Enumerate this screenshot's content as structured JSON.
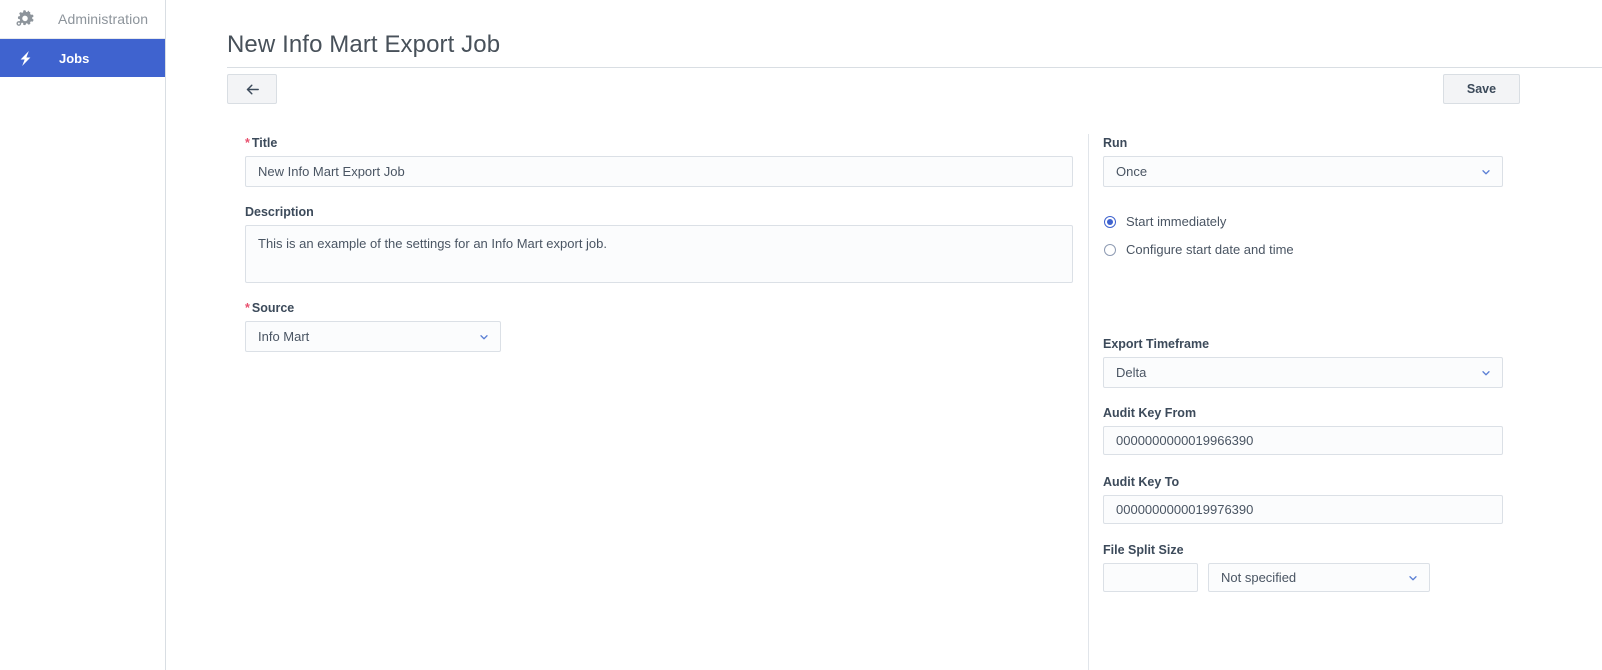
{
  "sidebar": {
    "items": [
      {
        "label": "Administration",
        "icon": "gears-icon",
        "active": false
      },
      {
        "label": "Jobs",
        "icon": "lightning-bolt-icon",
        "active": true
      }
    ]
  },
  "header": {
    "title": "New Info Mart Export Job"
  },
  "toolbar": {
    "back_icon": "arrow-left-icon",
    "save_label": "Save"
  },
  "left_form": {
    "title": {
      "label": "Title",
      "required_marker": "*",
      "value": "New Info Mart Export Job",
      "placeholder": ""
    },
    "description": {
      "label": "Description",
      "value": "This is an example of the settings for an Info Mart export job.",
      "placeholder": ""
    },
    "source": {
      "label": "Source",
      "required_marker": "*",
      "value": "Info Mart",
      "chevron": "chevron-down-icon"
    }
  },
  "right_form": {
    "run": {
      "label": "Run",
      "value": "Once",
      "chevron": "chevron-down-icon"
    },
    "schedule": {
      "options": [
        {
          "label": "Start immediately",
          "selected": true
        },
        {
          "label": "Configure start date and time",
          "selected": false
        }
      ]
    },
    "export_timeframe": {
      "label": "Export Timeframe",
      "value": "Delta",
      "chevron": "chevron-down-icon"
    },
    "audit_key_from": {
      "label": "Audit Key From",
      "value": "0000000000019966390",
      "placeholder": ""
    },
    "audit_key_to": {
      "label": "Audit Key To",
      "value": "0000000000019976390",
      "placeholder": ""
    },
    "file_split_size": {
      "label": "File Split Size",
      "value": "",
      "placeholder": "",
      "unit_value": "Not specified",
      "chevron": "chevron-down-icon"
    }
  },
  "colors": {
    "accent": "#3f63cf",
    "required": "#e8506e",
    "text": "#3c4a5a",
    "border": "#dbe0e6",
    "field_bg": "#fbfcfd",
    "button_bg": "#f3f4f6",
    "chevron": "#5b7fd4"
  }
}
